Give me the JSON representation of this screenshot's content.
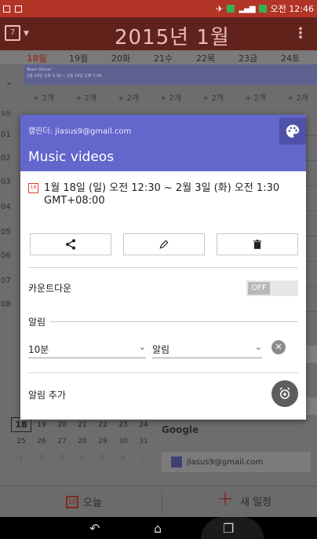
{
  "status_bar": {
    "time": "오전 12:46",
    "battery_icon": "battery-charging-icon",
    "signal_icon": "signal-icon"
  },
  "app_bar": {
    "title": "2015년 1월",
    "calendar_icon": "calendar-icon",
    "menu_icon": "overflow-menu-icon"
  },
  "week": {
    "days": [
      "18일",
      "19월",
      "20화",
      "21수",
      "22목",
      "23금",
      "24토"
    ],
    "event_strip": "Team Dinner\n1월 14일 오후 5:30 ~ 2월 14일 오후 7:30",
    "more": [
      "+ 2개",
      "+ 2개",
      "+ 2개",
      "+ 2개",
      "+ 2개",
      "+ 2개",
      "+ 2개"
    ],
    "hours": [
      "오전",
      "01",
      "02",
      "03",
      "04",
      "05",
      "06",
      "07",
      "08"
    ]
  },
  "dialog": {
    "calendar": "캘린더: jlasus9@gmail.com",
    "title": "Music videos",
    "when": "1월 18일 (일) 오전 12:30 ~ 2월 3일 (화) 오전 1:30",
    "timezone": "GMT+08:00",
    "countdown_label": "카운트다운",
    "countdown_toggle": "OFF",
    "alarm_section": "알림",
    "alarm_time": "10분",
    "alarm_type": "알림",
    "add_alarm": "알림 추가",
    "color": "#6366cb"
  },
  "mini_calendar": {
    "rows": [
      [
        "18",
        "19",
        "20",
        "21",
        "22",
        "23",
        "24"
      ],
      [
        "25",
        "26",
        "27",
        "28",
        "29",
        "30",
        "31"
      ],
      [
        "1",
        "2",
        "3",
        "4",
        "5",
        "6",
        "7"
      ]
    ]
  },
  "accounts": {
    "group": "Google",
    "email": "jlasus9@gmail.com"
  },
  "bottom_bar": {
    "today": "오늘",
    "new_event": "새 일정"
  }
}
